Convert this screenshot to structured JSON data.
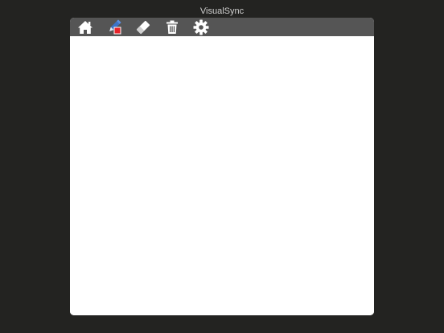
{
  "app": {
    "title": "VisualSync"
  },
  "toolbar": {
    "tools": [
      {
        "name": "home",
        "icon": "home-icon"
      },
      {
        "name": "pen",
        "icon": "pen-icon",
        "active_color": "#e8232a",
        "pen_color": "#3b73c8"
      },
      {
        "name": "eraser",
        "icon": "eraser-icon"
      },
      {
        "name": "delete",
        "icon": "trash-icon"
      },
      {
        "name": "settings",
        "icon": "gear-icon"
      }
    ]
  },
  "colors": {
    "background": "#232321",
    "toolbar": "#555555",
    "canvas": "#ffffff",
    "icon": "#ffffff"
  }
}
